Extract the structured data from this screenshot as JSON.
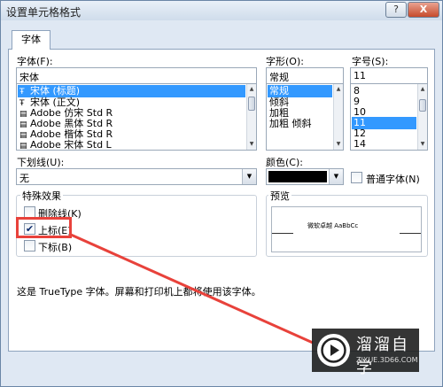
{
  "window": {
    "title": "设置单元格格式",
    "help_label": "?",
    "close_label": "X"
  },
  "tabs": {
    "font_tab": "字体"
  },
  "font": {
    "label": "字体(F):",
    "value": "宋体",
    "items": [
      {
        "icon": "Ŧ",
        "label": "宋体 (标题)"
      },
      {
        "icon": "Ŧ",
        "label": "宋体 (正文)"
      },
      {
        "icon": "▤",
        "label": "Adobe 仿宋 Std R"
      },
      {
        "icon": "▤",
        "label": "Adobe 黑体 Std R"
      },
      {
        "icon": "▤",
        "label": "Adobe 楷体 Std R"
      },
      {
        "icon": "▤",
        "label": "Adobe 宋体 Std L"
      }
    ]
  },
  "style": {
    "label": "字形(O):",
    "value": "常规",
    "items": [
      "常规",
      "倾斜",
      "加粗",
      "加粗 倾斜"
    ]
  },
  "size": {
    "label": "字号(S):",
    "value": "11",
    "items": [
      "8",
      "9",
      "10",
      "11",
      "12",
      "14"
    ]
  },
  "underline": {
    "label": "下划线(U):",
    "value": "无"
  },
  "color": {
    "label": "颜色(C):",
    "swatch": "#000000"
  },
  "normal_font": {
    "label": "普通字体(N)",
    "checked": false
  },
  "effects": {
    "title": "特殊效果",
    "strikethrough": "删除线(K)",
    "superscript": "上标(E)",
    "subscript": "下标(B)",
    "superscript_checked": true
  },
  "preview": {
    "title": "预览",
    "sample": "微软卓越 AaBbCc"
  },
  "info_text": "这是 TrueType 字体。屏幕和打印机上都将使用该字体。",
  "watermark": {
    "brand": "溜溜自学",
    "url": "ZIXUE.3D66.COM"
  },
  "colors": {
    "highlight": "#e8423b",
    "selection": "#3399ff"
  }
}
